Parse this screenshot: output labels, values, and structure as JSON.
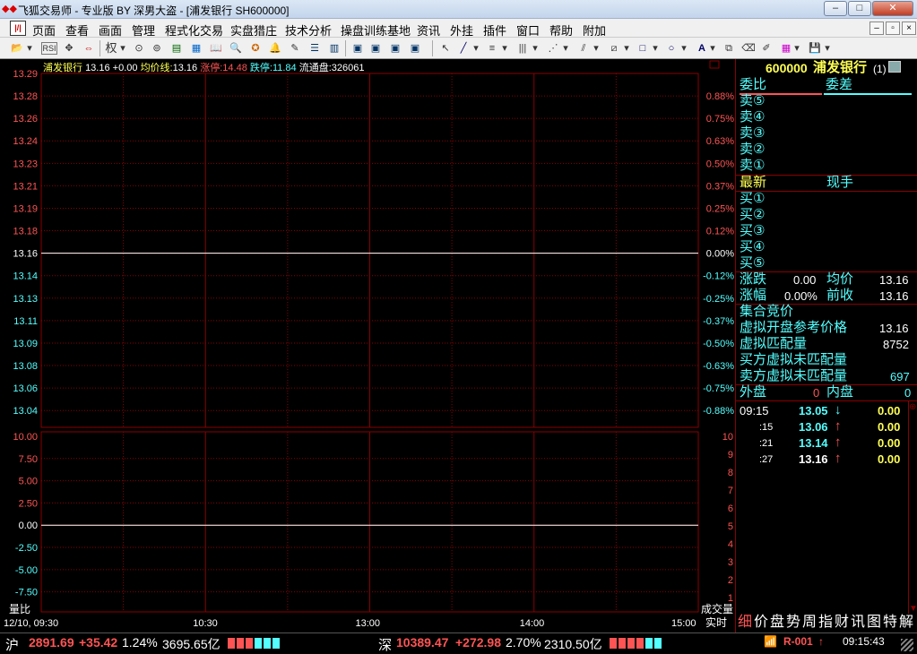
{
  "window": {
    "title": "飞狐交易师 - 专业版 BY 深男大盗 - [浦发银行 SH600000]",
    "btn_min": "–",
    "btn_max": "□",
    "btn_close": "✕"
  },
  "menu": {
    "items": [
      "页面",
      "查看",
      "画面",
      "管理",
      "程式化交易",
      "实盘猎庄",
      "技术分析",
      "操盘训练基地",
      "资讯",
      "外挂",
      "插件",
      "窗口",
      "帮助",
      "附加"
    ],
    "mdi_min": "–",
    "mdi_restore": "▫",
    "mdi_close": "×"
  },
  "toolbar": {
    "quan_label": "权"
  },
  "chart_header": {
    "name": "浦发银行",
    "price": "13.16",
    "change": "+0.00",
    "avg_label": "均价线:",
    "avg_value": "13.16",
    "limit_up_label": "涨停:",
    "limit_up_value": "14.48",
    "limit_down_label": "跌停:",
    "limit_down_value": "11.84",
    "float_label": "流通盘:",
    "float_value": "326061"
  },
  "chart_data": [
    {
      "type": "line",
      "title": "",
      "y_ticks": [
        "13.29",
        "13.28",
        "13.26",
        "13.24",
        "13.23",
        "13.21",
        "13.19",
        "13.18",
        "13.16",
        "13.14",
        "13.13",
        "13.11",
        "13.09",
        "13.08",
        "13.06",
        "13.04"
      ],
      "y_pct_ticks": [
        "0.88%",
        "0.75%",
        "0.63%",
        "0.50%",
        "0.37%",
        "0.25%",
        "0.12%",
        "0.00%",
        "-0.12%",
        "-0.25%",
        "-0.37%",
        "-0.50%",
        "-0.63%",
        "-0.75%",
        "-0.88%"
      ],
      "x_ticks": [
        "12/10, 09:30",
        "10:30",
        "13:00",
        "14:00",
        "15:00"
      ],
      "series": [
        {
          "values": [
            13.16,
            13.16
          ],
          "color": "#ffffff"
        }
      ],
      "ylim": [
        13.04,
        13.29
      ],
      "grid": true
    },
    {
      "type": "line",
      "ylabel_left": "量比",
      "ylabel_right": "成交量",
      "y_left_ticks": [
        "10.00",
        "7.50",
        "5.00",
        "2.50",
        "0.00",
        "-2.50",
        "-5.00",
        "-7.50"
      ],
      "y_right_ticks": [
        "10",
        "9",
        "8",
        "7",
        "6",
        "5",
        "4",
        "3",
        "2",
        "1"
      ],
      "series": [
        {
          "values": [
            0.0,
            0.0
          ],
          "color": "#ffffff"
        }
      ],
      "ylim": [
        -10,
        10
      ],
      "grid": true
    }
  ],
  "side_panel": {
    "code": "600000",
    "name": "浦发银行",
    "tag": "(1)",
    "weibi_label": "委比",
    "weicha_label": "委差",
    "sells": [
      "卖⑤",
      "卖④",
      "卖③",
      "卖②",
      "卖①"
    ],
    "latest_label": "最新",
    "current_hand_label": "现手",
    "buys": [
      "买①",
      "买②",
      "买③",
      "买④",
      "买⑤"
    ],
    "zhangdie_label": "涨跌",
    "zhangdie_value": "0.00",
    "junjia_label": "均价",
    "junjia_value": "13.16",
    "zhangfu_label": "涨幅",
    "zhangfu_value": "0.00%",
    "qianshou_label": "前收",
    "qianshou_value": "13.16",
    "auction_label": "集合竞价",
    "virtual_open_label": "虚拟开盘参考价格",
    "virtual_open_value": "13.16",
    "virtual_match_label": "虚拟匹配量",
    "virtual_match_value": "8752",
    "buy_unmatched_label": "买方虚拟未匹配量",
    "sell_unmatched_label": "卖方虚拟未匹配量",
    "sell_unmatched_value": "697",
    "waipan_label": "外盘",
    "waipan_value": "0",
    "neipan_label": "内盘",
    "neipan_value": "0",
    "ticks": [
      {
        "time": "09:15",
        "price": "13.05",
        "dir": "down",
        "vol": "0.00"
      },
      {
        "time": ":15",
        "price": "13.06",
        "dir": "up",
        "vol": "0.00"
      },
      {
        "time": ":21",
        "price": "13.14",
        "dir": "up",
        "vol": "0.00"
      },
      {
        "time": ":27",
        "price": "13.16",
        "dir": "up",
        "vol": "0.00"
      }
    ],
    "arrow_up": "↑",
    "arrow_down": "↓"
  },
  "bottom_tabs": {
    "realtime": "实时",
    "tabs": [
      "细",
      "价",
      "盘",
      "势",
      "周",
      "指",
      "财",
      "讯",
      "图",
      "特",
      "解"
    ]
  },
  "statusbar": {
    "sh_label": "沪",
    "sh_index": "2891.69",
    "sh_change": "+35.42",
    "sh_pct": "1.24%",
    "sh_amount": "3695.65亿",
    "sz_label": "深",
    "sz_index": "10389.47",
    "sz_change": "+272.98",
    "sz_pct": "2.70%",
    "sz_amount": "2310.50亿",
    "r_label": "R-001",
    "r_arrow": "↑",
    "clock": "09:15:43"
  },
  "colors": {
    "grid_red": "#8b0000",
    "up_red": "#ff5454",
    "down_cyan": "#54ffff",
    "text_yellow": "#ffff54"
  }
}
